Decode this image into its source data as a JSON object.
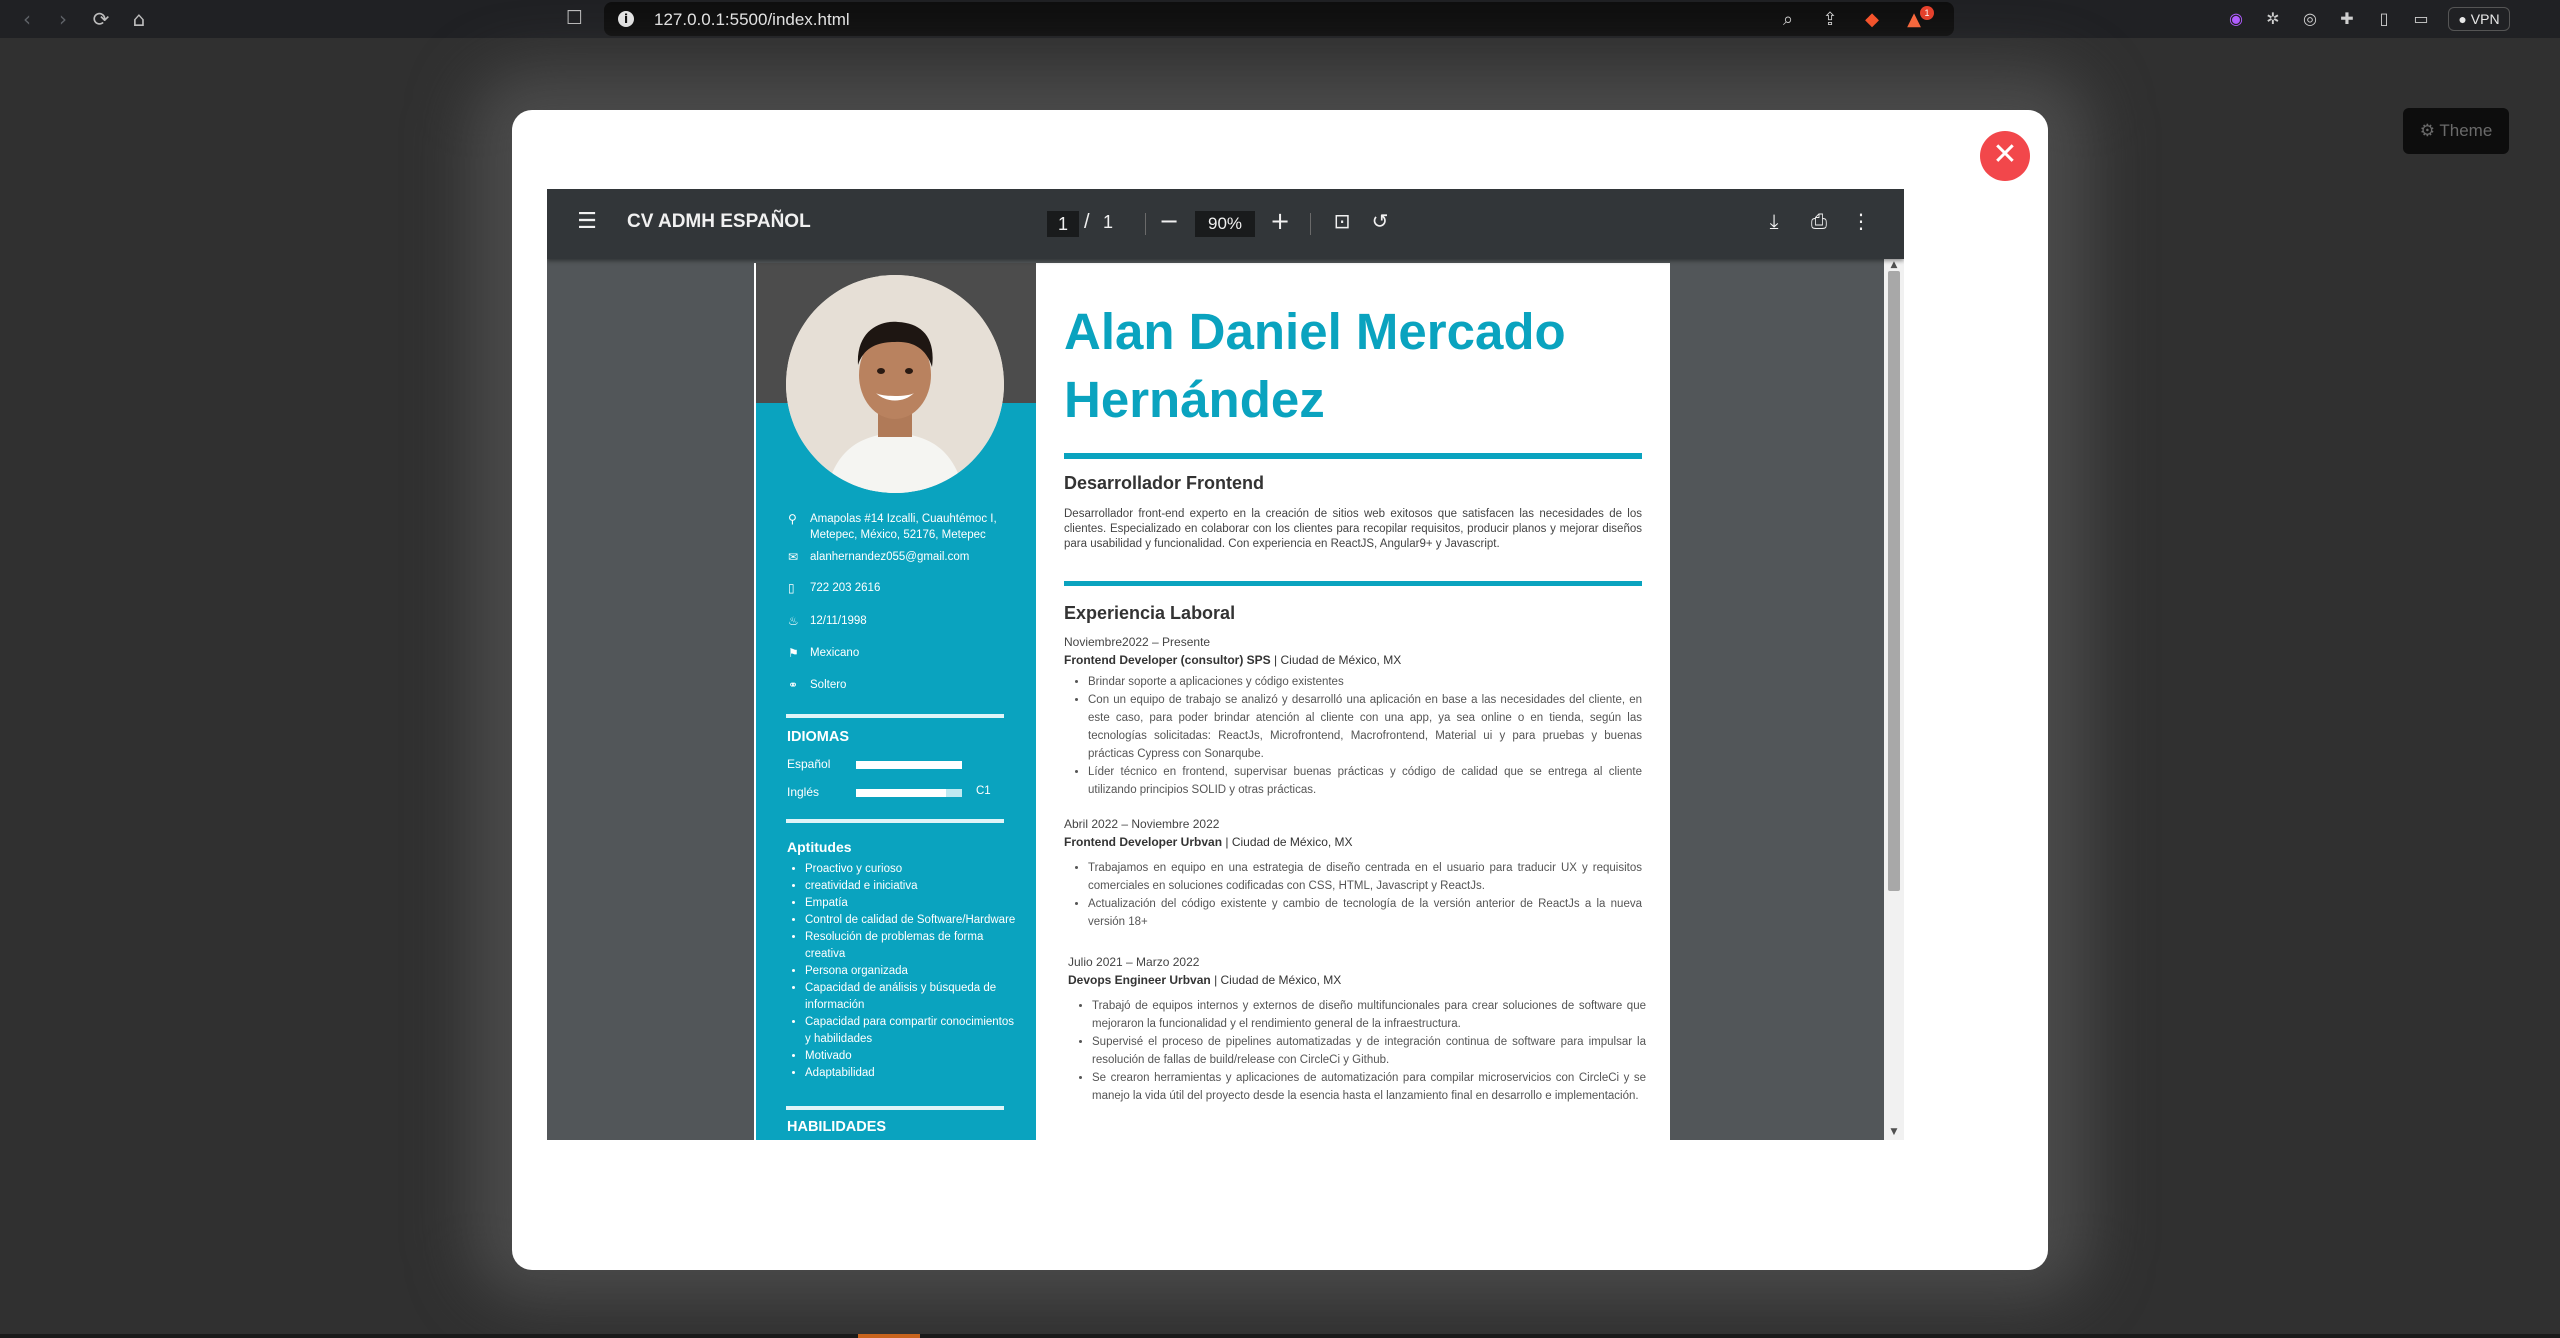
{
  "browser": {
    "url": "127.0.0.1:5500/index.html",
    "vpn_label": "VPN",
    "notification_count": "1"
  },
  "theme_button": {
    "label": "Theme"
  },
  "pdf_viewer": {
    "title": "CV ADMH ESPAÑOL",
    "current_page": "1",
    "page_separator": "/",
    "total_pages": "1",
    "zoom": "90%"
  },
  "cv": {
    "name": "Alan Daniel Mercado Hernández",
    "role": "Desarrollador Frontend",
    "summary": "Desarrollador front-end experto en la creación de sitios web exitosos que satisfacen las necesidades de los clientes. Especializado en colaborar con los clientes para recopilar requisitos, producir planos y mejorar diseños para usabilidad y funcionalidad. Con experiencia  en ReactJS, Angular9+ y Javascript.",
    "contact": {
      "address": "Amapolas #14 Izcalli, Cuauhtémoc I, Metepec, México, 52176, Metepec",
      "email": "alanhernandez055@gmail.com",
      "phone": "722 203 2616",
      "birthdate": "12/11/1998",
      "nationality": "Mexicano",
      "marital_status": "Soltero"
    },
    "languages_heading": "IDIOMAS",
    "languages": [
      {
        "name": "Español",
        "level": "",
        "proficiency": 1.0
      },
      {
        "name": "Inglés",
        "level": "C1",
        "proficiency": 0.85
      }
    ],
    "aptitudes_heading": "Aptitudes",
    "aptitudes": [
      "Proactivo y curioso",
      "creatividad e iniciativa",
      "Empatía",
      "Control de calidad de Software/Hardware",
      "Resolución de problemas de forma creativa",
      "Persona organizada",
      "Capacidad de análisis y búsqueda de información",
      "Capacidad para compartir conocimientos y habilidades",
      "Motivado",
      "Adaptabilidad"
    ],
    "skills_heading": "HABILIDADES",
    "experience_heading": "Experiencia Laboral",
    "jobs": [
      {
        "dates": "Noviembre2022 – Presente",
        "title": "Frontend Developer (consultor) SPS",
        "location": "| Ciudad de México, MX",
        "bullets": [
          "Brindar soporte a aplicaciones y  código existentes",
          "Con un equipo de trabajo se analizó y desarrolló una aplicación en base a las necesidades del cliente, en este caso, para poder brindar atención al cliente con una app, ya sea online o en tienda, según las tecnologías solicitadas: ReactJs, Microfrontend, Macrofrontend, Material ui y para pruebas y buenas prácticas Cypress con Sonarqube.",
          "Líder técnico en frontend, supervisar buenas prácticas y código de calidad que se entrega al cliente utilizando principios SOLID y otras prácticas."
        ]
      },
      {
        "dates": "Abril 2022 – Noviembre 2022",
        "title": "Frontend Developer Urbvan",
        "location": "| Ciudad de México, MX",
        "bullets": [
          "Trabajamos en equipo en una estrategia de diseño centrada en el usuario para traducir UX y requisitos comerciales en soluciones codificadas con CSS, HTML, Javascript y ReactJs.",
          "Actualización del código existente y cambio de tecnología de la versión anterior de ReactJs a la nueva versión 18+"
        ]
      },
      {
        "dates": "Julio 2021 – Marzo 2022",
        "title": "Devops Engineer Urbvan",
        "location": "| Ciudad de México, MX",
        "bullets": [
          "Trabajó de equipos internos y externos de diseño multifuncionales para crear soluciones de software que mejoraron la funcionalidad y el rendimiento general de la infraestructura.",
          "Supervisé el proceso de pipelines automatizadas y de integración continua de software para impulsar la resolución de fallas de build/release con CircleCi y Github.",
          "Se crearon herramientas y aplicaciones de automatización para compilar microservicios con CircleCi y se manejo la vida útil del proyecto desde la esencia hasta el lanzamiento final en desarrollo e implementación."
        ]
      }
    ]
  },
  "colors": {
    "accent": "#0aa3bf",
    "close": "#f2474b",
    "toolbar": "#323639"
  }
}
